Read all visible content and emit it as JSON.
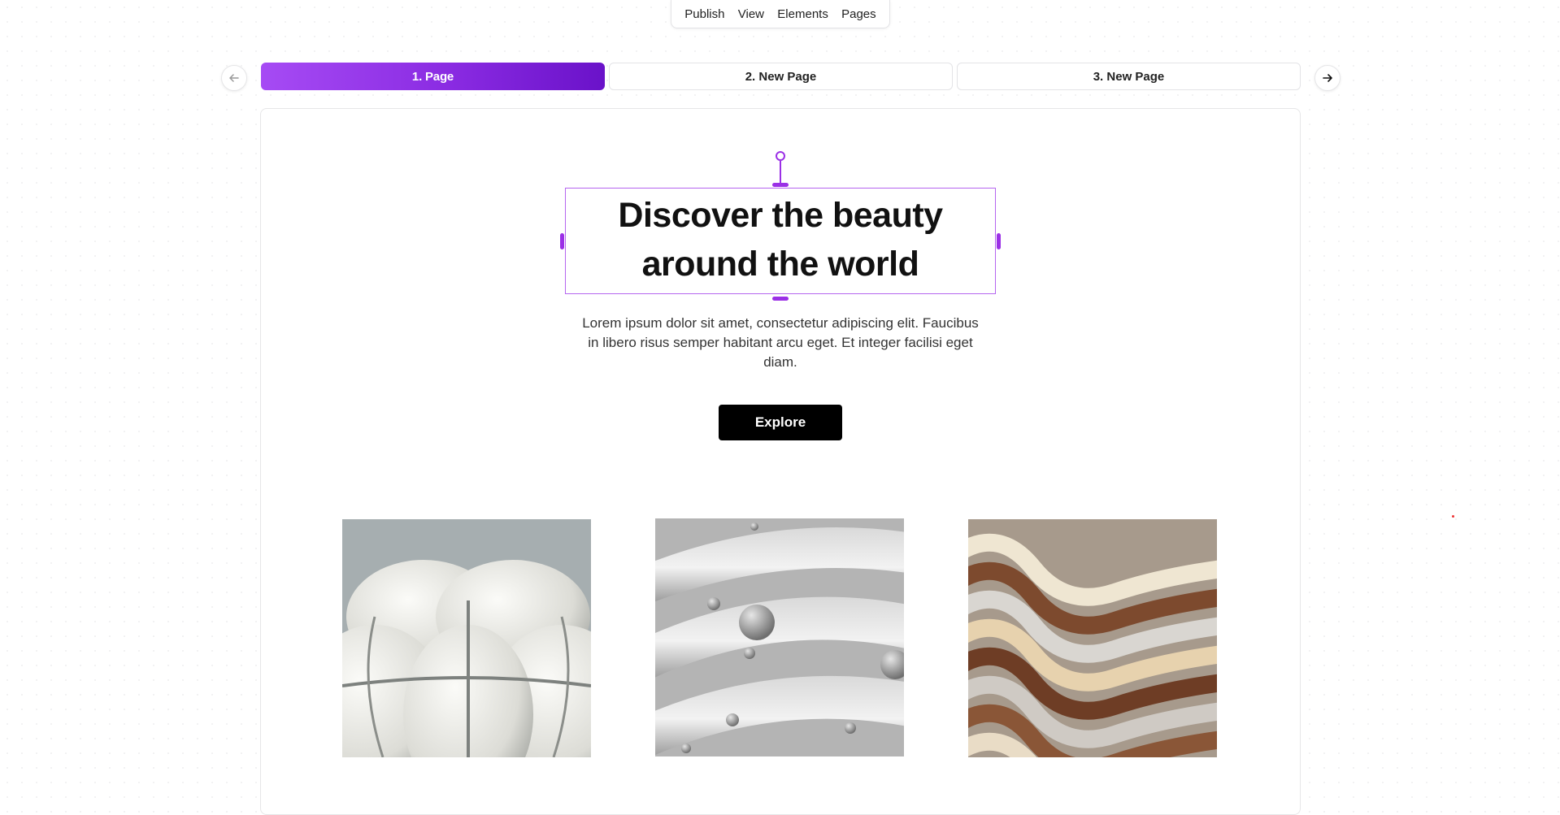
{
  "toolbar": {
    "items": [
      "Publish",
      "View",
      "Elements",
      "Pages"
    ]
  },
  "pages": {
    "tabs": [
      "1. Page",
      "2. New Page",
      "3. New Page"
    ],
    "active_index": 0
  },
  "hero": {
    "headline_line1": "Discover the beauty",
    "headline_line2": "around the world",
    "body_line1": "Lorem ipsum dolor sit amet, consectetur adipiscing elit. Faucibus",
    "body_line2": "in libero risus semper habitant arcu eget. Et integer facilisi eget",
    "body_line3": "diam.",
    "cta_label": "Explore"
  },
  "gallery": {
    "images": [
      "white-inflated-shapes-image",
      "grey-spiral-spheres-image",
      "brown-wave-ribbons-image"
    ]
  },
  "icons": {
    "prev": "arrow-left-icon",
    "next": "arrow-right-icon"
  },
  "colors": {
    "accent": "#8a2be2",
    "accent_light": "#a64bf4",
    "selection": "#9b30e6",
    "button_bg": "#000000"
  }
}
